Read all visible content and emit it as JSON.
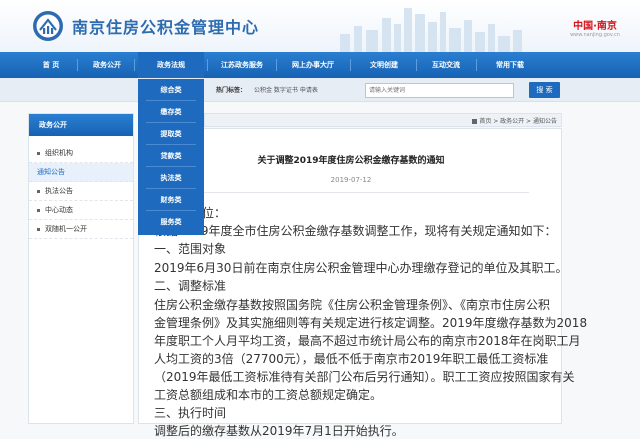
{
  "header": {
    "site_title": "南京住房公积金管理中心",
    "china_logo_text": "中国·南京",
    "china_logo_sub": "www.nanjing.gov.cn"
  },
  "nav": {
    "items": [
      "首 页",
      "政务公开",
      "政务法规",
      "江苏政务服务",
      "网上办事大厅",
      "文明创建",
      "互动交流",
      "常用下载"
    ]
  },
  "search": {
    "hot_label": "热门标签：",
    "hot_words": "公积金  数字证书  申请表",
    "placeholder": "请输入关键词",
    "button_label": "搜 索"
  },
  "dropdown": {
    "items": [
      "综合类",
      "缴存类",
      "提取类",
      "贷款类",
      "执法类",
      "财务类",
      "服务类"
    ]
  },
  "sidebar": {
    "header": "政务公开",
    "items": [
      {
        "label": "组织机构",
        "active": false
      },
      {
        "label": "通知公告",
        "active": true
      },
      {
        "label": "执法公告",
        "active": false
      },
      {
        "label": "中心动态",
        "active": false
      },
      {
        "label": "双随机一公开",
        "active": false
      }
    ]
  },
  "breadcrumb": "首页 > 政务公开 > 通知公告",
  "article": {
    "title": "关于调整2019年度住房公积金缴存基数的通知",
    "date": "2019-07-12",
    "lines": [
      "各缴存单位：",
      "根据2019年度全市住房公积金缴存基数调整工作，现将有关规定通知如下：",
      "一、范围对象",
      "2019年6月30日前在南京住房公积金管理中心办理缴存登记的单位及其职工。",
      "二、调整标准",
      "住房公积金缴存基数按照国务院《住房公积金管理条例》、《南京市住房公积",
      "金管理条例》及其实施细则等有关规定进行核定调整。2019年度缴存基数为2018",
      "年度职工个人月平均工资，最高不超过市统计局公布的南京市2018年在岗职工月",
      "人均工资的3倍（27700元），最低不低于南京市2019年职工最低工资标准",
      "（2019年最低工资标准待有关部门公布后另行通知）。职工工资应按照国家有关",
      "工资总额组成和本市的工资总额规定确定。",
      "三、执行时间",
      "调整后的缴存基数从2019年7月1日开始执行。"
    ]
  }
}
